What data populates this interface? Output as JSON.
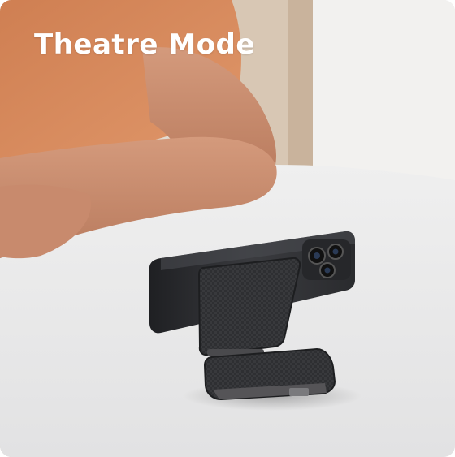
{
  "headline": {
    "text": "Theatre Mode"
  },
  "scene": {
    "description_icon": "phone-on-folding-stand-photo",
    "colors": {
      "table": "#e8e8e9",
      "wall": "#efeeec",
      "shirt": "#d98a5e",
      "skin": "#c98a6e",
      "phone": "#2f3033",
      "stand": "#3a3a3c"
    }
  }
}
